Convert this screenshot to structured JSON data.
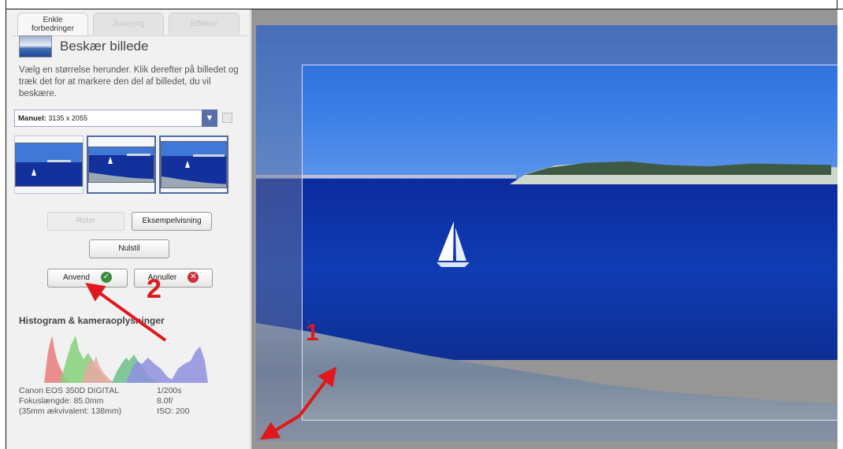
{
  "tabs": [
    {
      "label": "Enkle forbedringer",
      "line1": "Enkle",
      "line2": "forbedringer",
      "active": true
    },
    {
      "label": "Justering",
      "active": false
    },
    {
      "label": "Effekter",
      "active": false
    }
  ],
  "tool": {
    "title": "Beskær billede",
    "description": "Vælg en størrelse herunder. Klik derefter på billedet og træk det for at markere den del af billedet, du vil beskære."
  },
  "crop_select": {
    "prefix": "Manuel:",
    "value": "3135 x 2055"
  },
  "presets": [
    "crop-preset-1",
    "crop-preset-2",
    "crop-preset-3"
  ],
  "buttons": {
    "rotate": "Roter",
    "preview": "Eksempelvisning",
    "reset": "Nulstil",
    "apply": "Anvend",
    "cancel": "Annuller"
  },
  "histogram": {
    "title": "Histogram & kameraoplysninger"
  },
  "camera_info": {
    "model": "Canon EOS 350D DIGITAL",
    "shutter": "1/200s",
    "focal_label": "Fokuslængde: 85.0mm",
    "aperture": "8.0f/",
    "equiv_label": "(35mm ækvivalent: 138mm)",
    "iso": "ISO: 200"
  },
  "annotations": {
    "step1": "1",
    "step2": "2"
  },
  "colors": {
    "annotation_red": "#e0181b",
    "accent_blue": "#5a6fa7"
  }
}
